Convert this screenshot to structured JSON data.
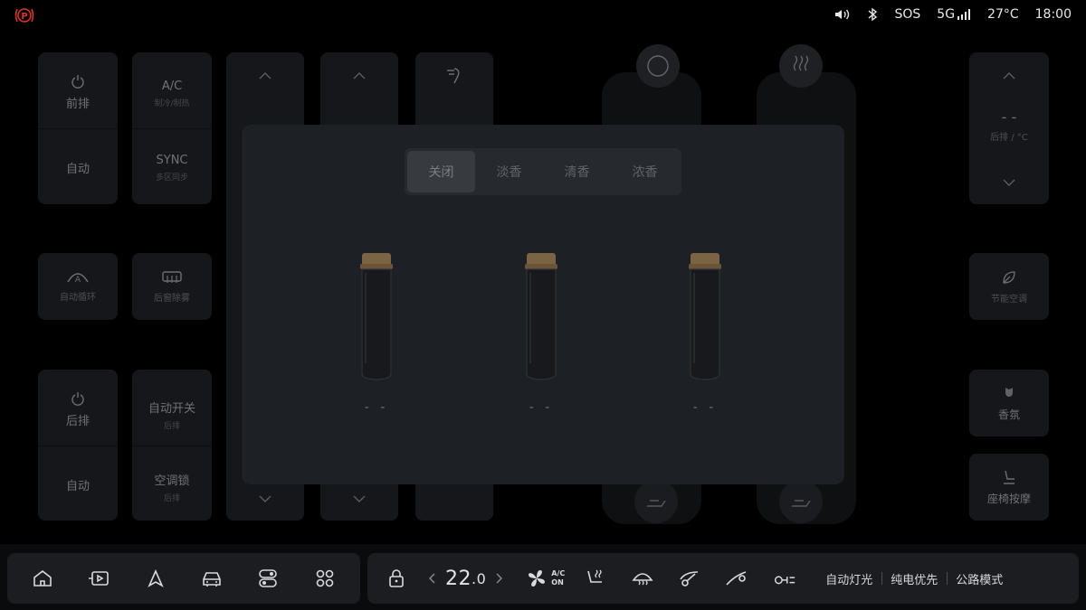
{
  "status_bar": {
    "sos": "SOS",
    "network": "5G",
    "temperature": "27°C",
    "time": "18:00",
    "colors": {
      "park_brake": "#d9342b"
    }
  },
  "background_panel": {
    "front_label": "前排",
    "front_auto": "自动",
    "ac_label": "A/C",
    "ac_sub": "制冷/制热",
    "sync_label": "SYNC",
    "sync_sub": "多区同步",
    "auto_circulation": "自动循环",
    "rear_defrost": "后窗除雾",
    "rear_label": "后排",
    "rear_auto": "自动",
    "auto_switch_label": "自动开关",
    "auto_switch_sub": "后排",
    "ac_lock_label": "空调锁",
    "ac_lock_sub": "后排",
    "rear_temp_value": "- -",
    "rear_temp_unit": "后排 / °C",
    "eco_ac": "节能空调",
    "fragrance": "香氛",
    "seat_massage": "座椅按摩"
  },
  "fragrance_modal": {
    "tabs": [
      {
        "label": "关闭",
        "active": true
      },
      {
        "label": "淡香",
        "active": false
      },
      {
        "label": "清香",
        "active": false
      },
      {
        "label": "浓香",
        "active": false
      }
    ],
    "vials": [
      {
        "label": "- -"
      },
      {
        "label": "- -"
      },
      {
        "label": "- -"
      }
    ]
  },
  "dock": {
    "temperature_int": "22",
    "temperature_dec": ".0",
    "ac_badge_top": "A/C",
    "ac_badge_bottom": "ON",
    "modes": [
      "自动灯光",
      "纯电优先",
      "公路模式"
    ]
  }
}
